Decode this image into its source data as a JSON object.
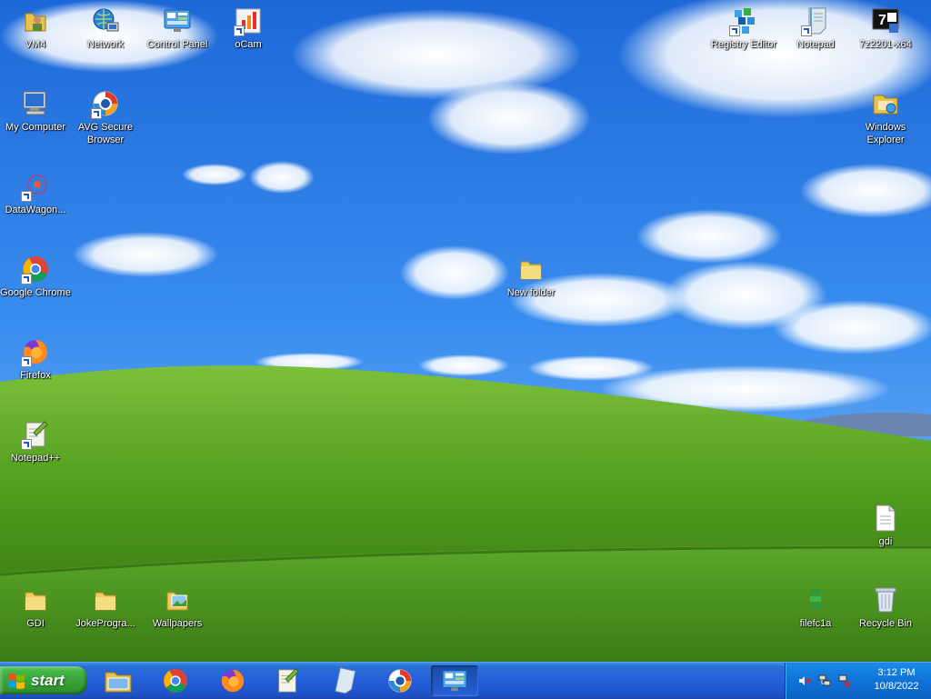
{
  "desktop": {
    "icons": {
      "vm4": "VM4",
      "network": "Network",
      "control_panel": "Control Panel",
      "ocam": "oCam",
      "registry_editor": "Registry Editor",
      "notepad": "Notepad",
      "sevenzip": "7z2201-x64",
      "my_computer": "My Computer",
      "avg": "AVG Secure Browser",
      "windows_explorer": "Windows Explorer",
      "datawagon": "DataWagon...",
      "google_chrome": "Google Chrome",
      "new_folder": "New folder",
      "firefox": "Firefox",
      "notepadpp": "Notepad++",
      "gdi_file": "gdi",
      "gdi_folder": "GDI",
      "joke_programs": "JokeProgra...",
      "wallpapers": "Wallpapers",
      "filefc1a": "filefc1a",
      "recycle_bin": "Recycle Bin"
    }
  },
  "taskbar": {
    "start_label": "start",
    "items": [
      "file-explorer-icon",
      "chrome-icon",
      "firefox-icon",
      "notepadpp-icon",
      "notepad-icon",
      "avg-icon",
      "control-panel-icon"
    ],
    "active_item": "control-panel-icon"
  },
  "tray": {
    "icons": [
      "volume-muted-icon",
      "network-icon",
      "network-disconnected-icon"
    ],
    "time": "3:12 PM",
    "date": "10/8/2022"
  },
  "colors": {
    "sky": "#2f7be8",
    "hill": "#4f9a1e",
    "taskbar": "#245edb",
    "start": "#3aa63a",
    "tray": "#0f73d8"
  }
}
